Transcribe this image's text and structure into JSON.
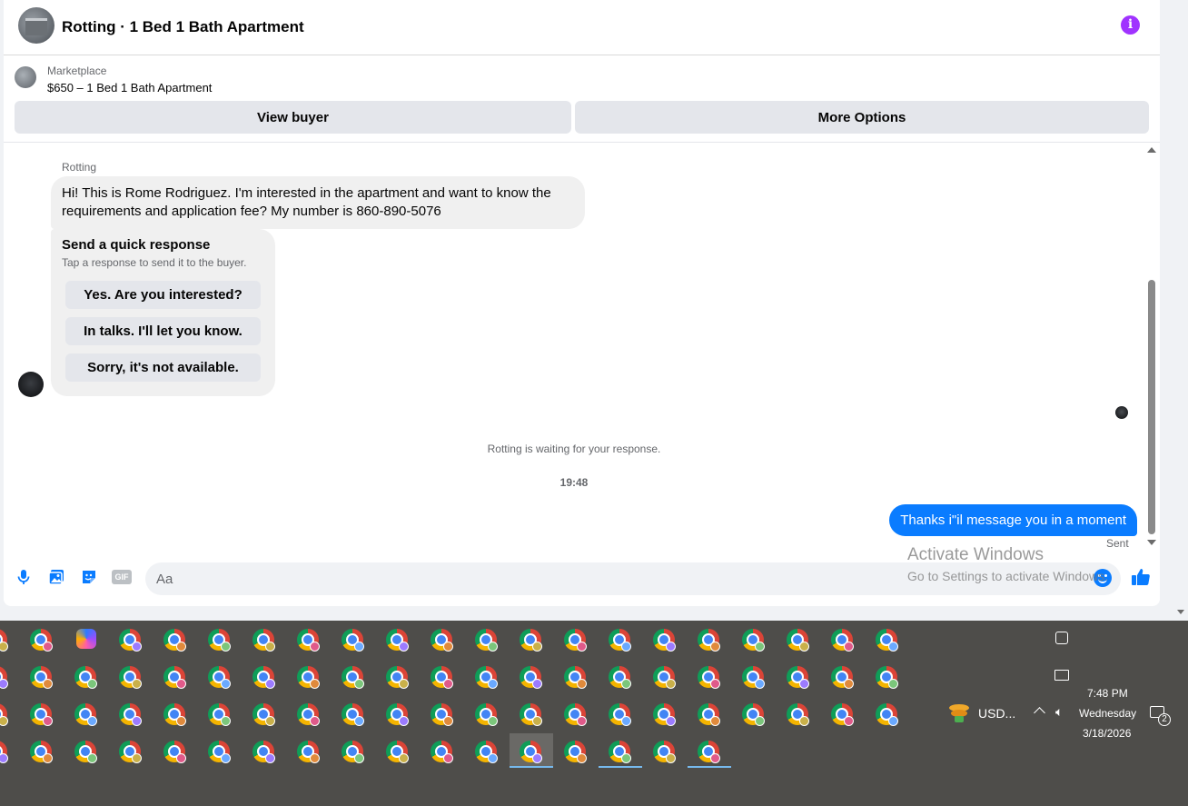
{
  "header": {
    "title": "Rotting · 1 Bed 1 Bath Apartment"
  },
  "listing": {
    "source": "Marketplace",
    "price_title": "$650 – 1 Bed 1 Bath Apartment",
    "view_buyer_label": "View buyer",
    "more_options_label": "More Options"
  },
  "messages": {
    "sender_name": "Rotting",
    "incoming_text": "Hi! This is Rome Rodriguez. I'm interested in the apartment and want to know the requirements and application fee? My number is 860-890-5076",
    "quick_response": {
      "title": "Send a quick response",
      "subtitle": "Tap a response to send it to the buyer.",
      "options": [
        "Yes. Are you interested?",
        "In talks. I'll let you know.",
        "Sorry, it's not available."
      ]
    },
    "waiting_notice": "Rotting is waiting for your response.",
    "timestamp": "19:48",
    "outgoing_text": "Thanks i\"il message you in a moment",
    "sent_status": "Sent"
  },
  "composer": {
    "placeholder": "Aa",
    "gif_label": "GIF"
  },
  "watermark": {
    "line1": "Activate Windows",
    "line2": "Go to Settings to activate Windows."
  },
  "taskbar": {
    "currency": "USD...",
    "time": "7:48 PM",
    "day": "Wednesday",
    "date": "3/18/2026",
    "notification_count": "2"
  },
  "colors": {
    "accent_blue": "#0a7cff",
    "info_purple": "#a033ff",
    "taskbar_bg": "#4e4d4a"
  }
}
